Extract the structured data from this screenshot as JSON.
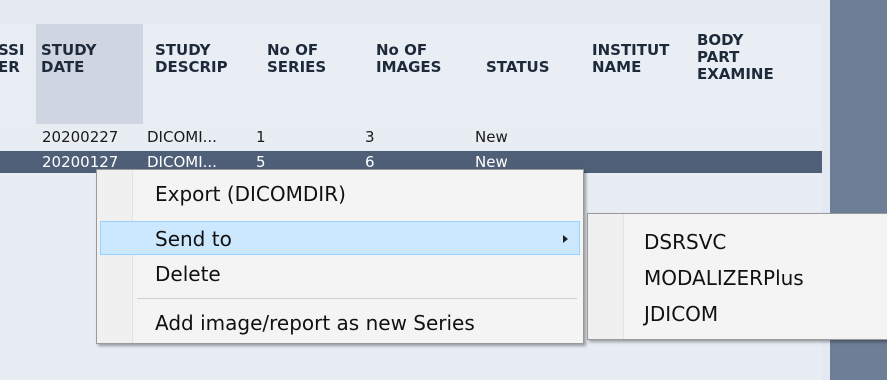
{
  "table": {
    "columns": [
      {
        "key": "accession",
        "label": "SSI\nER"
      },
      {
        "key": "study_date",
        "label": "STUDY\nDATE"
      },
      {
        "key": "study_desc",
        "label": "STUDY\nDESCRIP"
      },
      {
        "key": "no_series",
        "label": "No OF\nSERIES"
      },
      {
        "key": "no_images",
        "label": "No OF\nIMAGES"
      },
      {
        "key": "status",
        "label": "STATUS"
      },
      {
        "key": "institution",
        "label": "INSTITUT\nNAME"
      },
      {
        "key": "body_part",
        "label": "BODY\nPART\nEXAMINE"
      }
    ],
    "rows": [
      {
        "study_date": "20200227",
        "study_desc": "DICOMI...",
        "no_series": "1",
        "no_images": "3",
        "status": "New"
      },
      {
        "study_date": "20200127",
        "study_desc": "DICOMI...",
        "no_series": "5",
        "no_images": "6",
        "status": "New"
      }
    ]
  },
  "context_menu": {
    "items": [
      {
        "label": "Export (DICOMDIR)"
      },
      {
        "label": "Send to"
      },
      {
        "label": "Delete"
      },
      {
        "label": "Add image/report as new Series"
      }
    ]
  },
  "submenu": {
    "items": [
      {
        "label": "DSRSVC"
      },
      {
        "label": "MODALIZERPlus"
      },
      {
        "label": "JDICOM"
      }
    ]
  },
  "colors": {
    "selected_row": "#4f5f78",
    "menu_highlight": "#cce8ff",
    "side_panel": "#6d7e97"
  }
}
